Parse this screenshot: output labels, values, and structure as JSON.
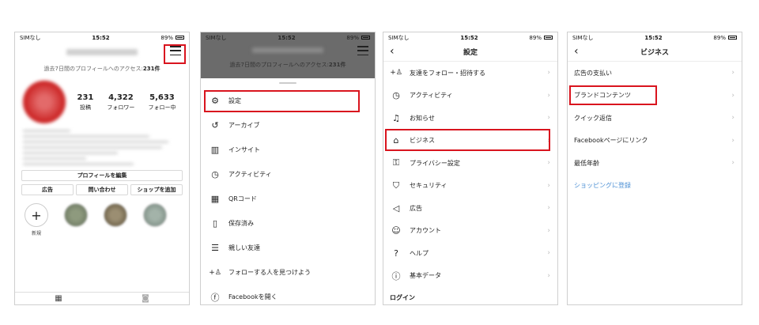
{
  "status": {
    "carrier": "SIMなし",
    "time": "15:52",
    "battery": "89%"
  },
  "profile": {
    "access_text": "過去7日間のプロフィールへのアクセス:",
    "access_count": "231件",
    "stats": [
      {
        "value": "231",
        "label": "投稿"
      },
      {
        "value": "4,322",
        "label": "フォロワー"
      },
      {
        "value": "5,633",
        "label": "フォロー中"
      }
    ],
    "edit_button": "プロフィールを編集",
    "buttons": [
      "広告",
      "問い合わせ",
      "ショップを追加"
    ],
    "new_highlight": "新規"
  },
  "menu": {
    "items": [
      {
        "icon": "gear-icon",
        "glyph": "⚙",
        "label": "設定"
      },
      {
        "icon": "archive-icon",
        "glyph": "↺",
        "label": "アーカイブ"
      },
      {
        "icon": "insights-icon",
        "glyph": "▥",
        "label": "インサイト"
      },
      {
        "icon": "activity-icon",
        "glyph": "◷",
        "label": "アクティビティ"
      },
      {
        "icon": "qr-code-icon",
        "glyph": "▦",
        "label": "QRコード"
      },
      {
        "icon": "bookmark-icon",
        "glyph": "▯",
        "label": "保存済み"
      },
      {
        "icon": "close-friends-icon",
        "glyph": "☰",
        "label": "親しい友達"
      },
      {
        "icon": "discover-people-icon",
        "glyph": "+♙",
        "label": "フォローする人を見つけよう"
      },
      {
        "icon": "facebook-icon",
        "glyph": "ⓕ",
        "label": "Facebookを開く"
      }
    ]
  },
  "settings": {
    "title": "設定",
    "items": [
      {
        "icon": "add-person-icon",
        "glyph": "+♙",
        "label": "友達をフォロー・招待する"
      },
      {
        "icon": "activity-icon",
        "glyph": "◷",
        "label": "アクティビティ"
      },
      {
        "icon": "bell-icon",
        "glyph": "♫",
        "label": "お知らせ"
      },
      {
        "icon": "shop-icon",
        "glyph": "⌂",
        "label": "ビジネス"
      },
      {
        "icon": "lock-icon",
        "glyph": "⚿",
        "label": "プライバシー設定"
      },
      {
        "icon": "shield-icon",
        "glyph": "⛉",
        "label": "セキュリティ"
      },
      {
        "icon": "megaphone-icon",
        "glyph": "◁",
        "label": "広告"
      },
      {
        "icon": "account-icon",
        "glyph": "☺",
        "label": "アカウント"
      },
      {
        "icon": "help-icon",
        "glyph": "?",
        "label": "ヘルプ"
      },
      {
        "icon": "info-icon",
        "glyph": "ⓘ",
        "label": "基本データ"
      }
    ],
    "section_login": "ログイン"
  },
  "business": {
    "title": "ビジネス",
    "items": [
      {
        "label": "広告の支払い"
      },
      {
        "label": "ブランドコンテンツ"
      },
      {
        "label": "クイック返信"
      },
      {
        "label": "Facebookページにリンク"
      },
      {
        "label": "最低年齢"
      }
    ],
    "shopping_link": "ショッピングに登録"
  },
  "colors": {
    "highlight_border": "#d9141e",
    "link_blue": "#4b8fd4"
  }
}
